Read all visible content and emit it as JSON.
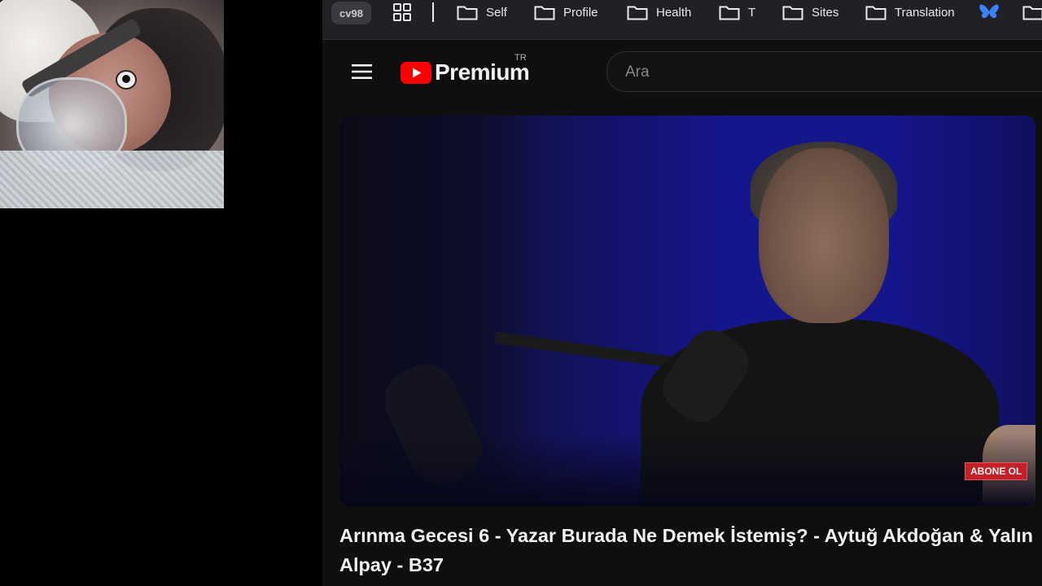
{
  "bookmarks_bar": {
    "profile_chip": "cv98",
    "items": [
      {
        "label": "Self",
        "icon": "folder-icon"
      },
      {
        "label": "Profile",
        "icon": "folder-icon"
      },
      {
        "label": "Health",
        "icon": "folder-icon"
      },
      {
        "label": "T",
        "icon": "folder-icon"
      },
      {
        "label": "Sites",
        "icon": "folder-icon"
      },
      {
        "label": "Translation",
        "icon": "folder-icon"
      },
      {
        "label": "",
        "icon": "bluesky-icon"
      },
      {
        "label": "",
        "icon": "folder-icon"
      }
    ]
  },
  "youtube": {
    "logo_text": "Premium",
    "region": "TR",
    "search_placeholder": "Ara",
    "brand_color": "#ff0000"
  },
  "video": {
    "overlay_badge": "ABONE OL",
    "title": "Arınma Gecesi 6 - Yazar Burada Ne Demek İstemiş? - Aytuğ Akdoğan & Yalın Alpay - B37"
  }
}
